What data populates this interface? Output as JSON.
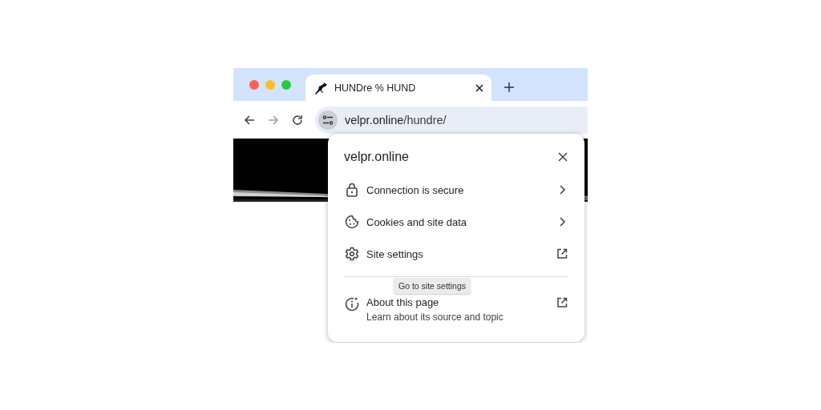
{
  "tab": {
    "title": "HUNDre % HUND",
    "selected": true
  },
  "address_bar": {
    "host": "velpr.online",
    "path": "/hundre/"
  },
  "nav": {
    "back_disabled": false,
    "forward_disabled": true
  },
  "site_info_popup": {
    "title": "velpr.online",
    "items": [
      {
        "kind": "submenu",
        "label": "Connection is secure"
      },
      {
        "kind": "submenu",
        "label": "Cookies and site data"
      },
      {
        "kind": "external",
        "label": "Site settings"
      }
    ],
    "about": {
      "label": "About this page",
      "description": "Learn about its source and topic"
    },
    "tooltip": "Go to site settings"
  }
}
